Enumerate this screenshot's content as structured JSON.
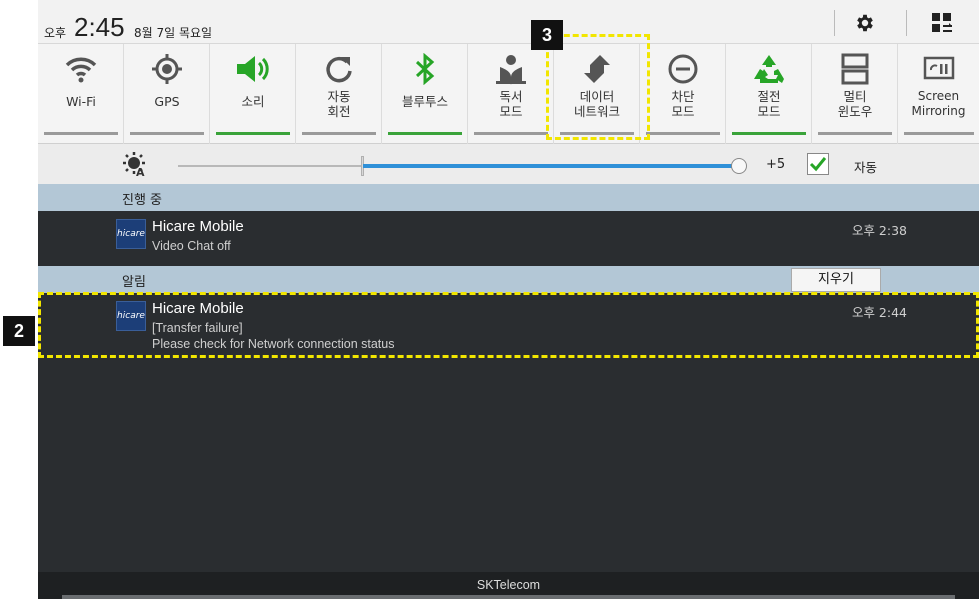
{
  "status_bar": {
    "ampm": "오후",
    "time": "2:45",
    "date": "8월 7일 목요일"
  },
  "quick_settings": [
    {
      "label": "Wi-Fi",
      "icon": "wifi-icon",
      "active": false
    },
    {
      "label": "GPS",
      "icon": "gps-icon",
      "active": false
    },
    {
      "label": "소리",
      "icon": "sound-icon",
      "active": true
    },
    {
      "label": "자동\n회전",
      "icon": "auto-rotate-icon",
      "active": false
    },
    {
      "label": "블루투스",
      "icon": "bluetooth-icon",
      "active": true
    },
    {
      "label": "독서\n모드",
      "icon": "reading-mode-icon",
      "active": false
    },
    {
      "label": "데이터\n네트워크",
      "icon": "data-network-icon",
      "active": false
    },
    {
      "label": "차단\n모드",
      "icon": "blocking-mode-icon",
      "active": false
    },
    {
      "label": "절전\n모드",
      "icon": "power-saving-icon",
      "active": true
    },
    {
      "label": "멀티\n윈도우",
      "icon": "multi-window-icon",
      "active": false
    },
    {
      "label": "Screen\nMirroring",
      "icon": "screen-mirroring-icon",
      "active": false
    }
  ],
  "brightness": {
    "level_fraction": 0.33,
    "value_label": "+5",
    "auto_checked": true,
    "auto_label": "자동"
  },
  "ongoing": {
    "header": "진행 중",
    "items": [
      {
        "app": "Hicare Mobile",
        "lines": [
          "Video Chat off"
        ],
        "time": "오후 2:38",
        "icon_text": "hicare"
      }
    ]
  },
  "notifications": {
    "header": "알림",
    "clear_label": "지우기",
    "items": [
      {
        "app": "Hicare Mobile",
        "lines": [
          "[Transfer failure]",
          "Please check for Network connection status"
        ],
        "time": "오후 2:44",
        "icon_text": "hicare"
      }
    ]
  },
  "footer": {
    "carrier": "SKTelecom"
  },
  "annotations": {
    "callout_2": "2",
    "callout_3": "3",
    "highlight_color": "#f2e600"
  },
  "colors": {
    "active_bar": "#3aa33a",
    "brightness_track": "#2f90d8",
    "section_header": "#b3c7d6",
    "panel_bg": "#2a2d30"
  }
}
